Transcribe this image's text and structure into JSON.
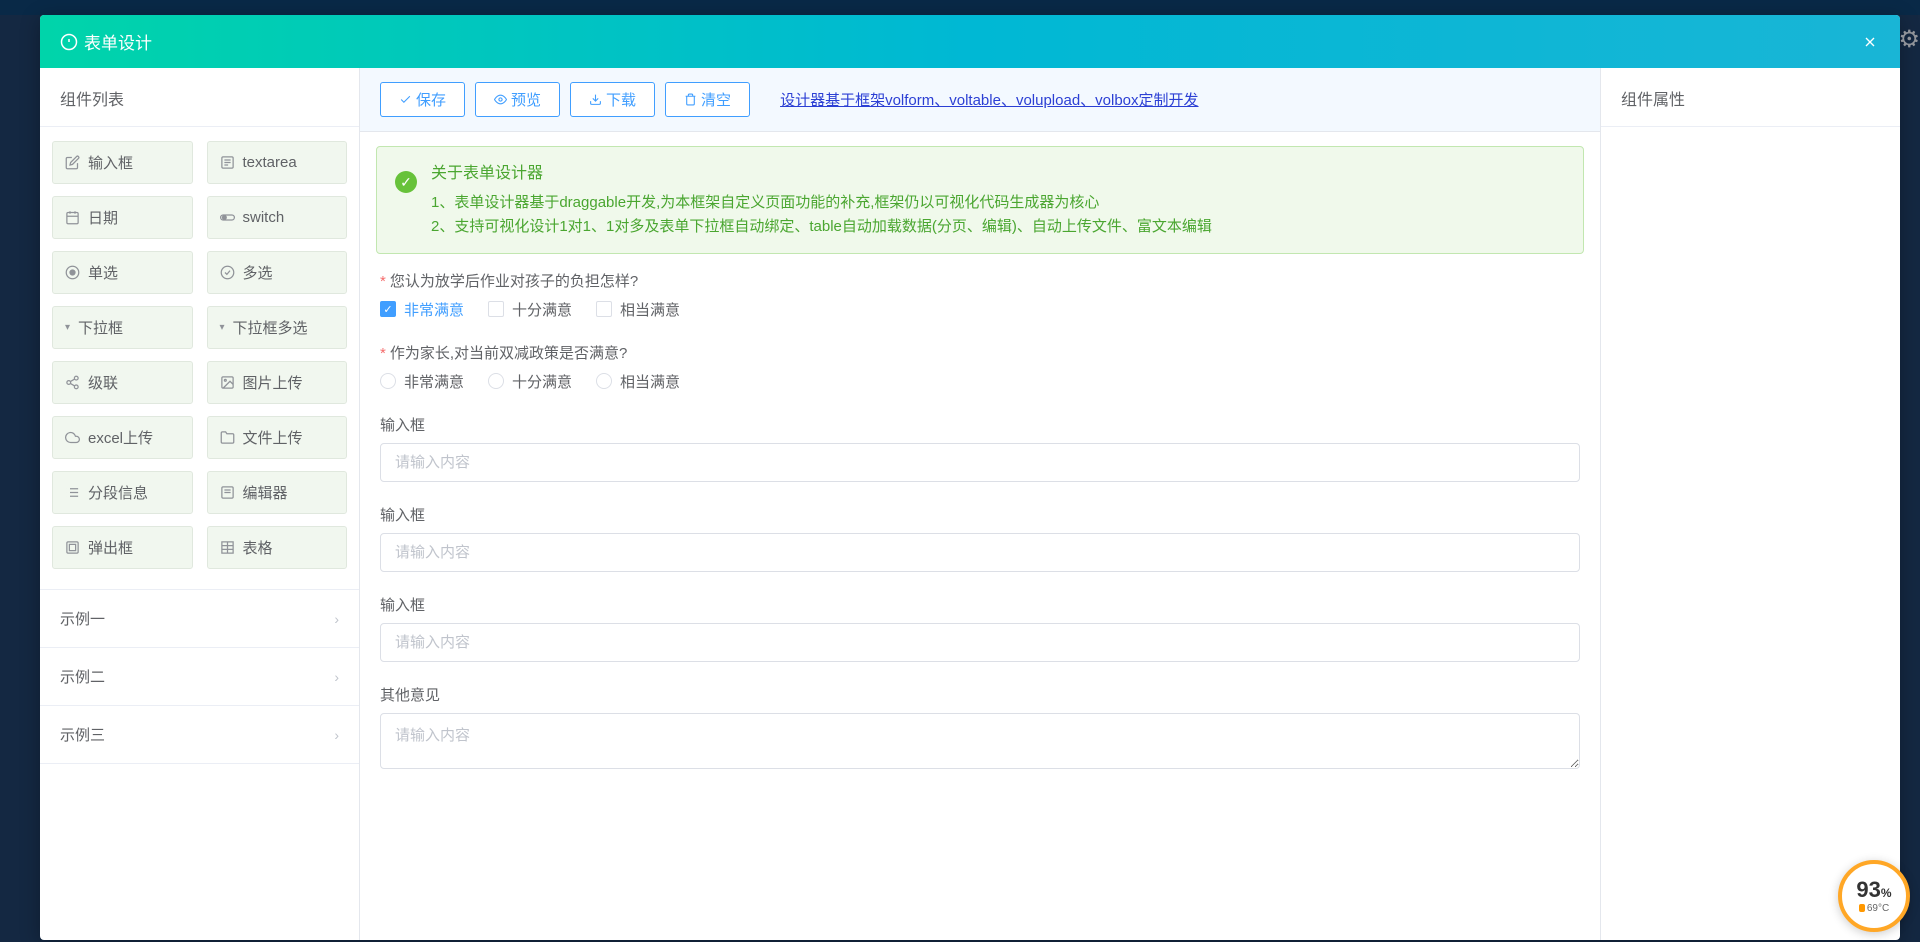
{
  "modal": {
    "title": "表单设计"
  },
  "leftPanel": {
    "title": "组件列表",
    "components": [
      {
        "icon": "edit",
        "label": "输入框"
      },
      {
        "icon": "textarea",
        "label": "textarea"
      },
      {
        "icon": "calendar",
        "label": "日期"
      },
      {
        "icon": "switch",
        "label": "switch"
      },
      {
        "icon": "radio",
        "label": "单选"
      },
      {
        "icon": "check",
        "label": "多选"
      },
      {
        "icon": "dropdown",
        "label": "下拉框",
        "hasArrow": true
      },
      {
        "icon": "dropdown",
        "label": "下拉框多选",
        "hasArrow": true
      },
      {
        "icon": "cascade",
        "label": "级联"
      },
      {
        "icon": "image",
        "label": "图片上传"
      },
      {
        "icon": "cloud",
        "label": "excel上传"
      },
      {
        "icon": "folder",
        "label": "文件上传"
      },
      {
        "icon": "section",
        "label": "分段信息"
      },
      {
        "icon": "editor",
        "label": "编辑器"
      },
      {
        "icon": "popup",
        "label": "弹出框"
      },
      {
        "icon": "table",
        "label": "表格"
      }
    ],
    "examples": [
      "示例一",
      "示例二",
      "示例三"
    ]
  },
  "toolbar": {
    "save": "保存",
    "preview": "预览",
    "download": "下载",
    "clear": "清空",
    "link": "设计器基于框架volform、voltable、volupload、volbox定制开发"
  },
  "banner": {
    "title": "关于表单设计器",
    "line1": "1、表单设计器基于draggable开发,为本框架自定义页面功能的补充,框架仍以可视化代码生成器为核心",
    "line2": "2、支持可视化设计1对1、1对多及表单下拉框自动绑定、table自动加载数据(分页、编辑)、自动上传文件、富文本编辑"
  },
  "form": {
    "q1": {
      "label": "您认为放学后作业对孩子的负担怎样?",
      "options": [
        "非常满意",
        "十分满意",
        "相当满意"
      ],
      "checked": 0
    },
    "q2": {
      "label": "作为家长,对当前双减政策是否满意?",
      "options": [
        "非常满意",
        "十分满意",
        "相当满意"
      ]
    },
    "input1": {
      "label": "输入框",
      "placeholder": "请输入内容"
    },
    "input2": {
      "label": "输入框",
      "placeholder": "请输入内容"
    },
    "input3": {
      "label": "输入框",
      "placeholder": "请输入内容"
    },
    "other": {
      "label": "其他意见",
      "placeholder": "请输入内容"
    }
  },
  "rightPanel": {
    "title": "组件属性"
  },
  "widget": {
    "value": "93",
    "temp": "69°C"
  }
}
